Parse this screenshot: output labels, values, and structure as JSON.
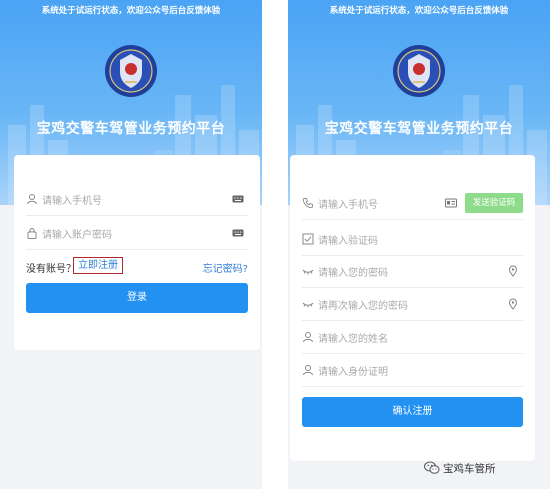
{
  "left": {
    "notice": "系统处于试运行状态，欢迎公众号后台反馈体验",
    "title": "宝鸡交警车驾管业务预约平台",
    "phone_placeholder": "请输入手机号",
    "password_placeholder": "请输入账户密码",
    "no_account": "没有账号？",
    "register_label": "立即注册",
    "forgot_label": "忘记密码?",
    "login_label": "登录"
  },
  "right": {
    "notice": "系统处于试运行状态，欢迎公众号后台反馈体验",
    "title": "宝鸡交警车驾管业务预约平台",
    "phone_placeholder": "请输入手机号",
    "send_code_label": "发送验证码",
    "code_placeholder": "请输入验证码",
    "password_placeholder": "请输入您的密码",
    "password_confirm_placeholder": "请再次输入您的密码",
    "name_placeholder": "请输入您的姓名",
    "id_placeholder": "请输入身份证明",
    "confirm_label": "确认注册"
  },
  "watermark": "宝鸡车管所",
  "colors": {
    "primary": "#2391f2",
    "sms": "#8edc8b",
    "highlight": "#b3282d",
    "link": "#2f80d8",
    "hero": "#4aa3f4"
  },
  "icons": [
    "police-emblem-icon",
    "user-icon",
    "lock-icon",
    "keyboard-icon",
    "phone-icon",
    "id-card-icon",
    "checkbox-icon",
    "eye-closed-icon",
    "location-pin-icon",
    "wechat-icon"
  ]
}
